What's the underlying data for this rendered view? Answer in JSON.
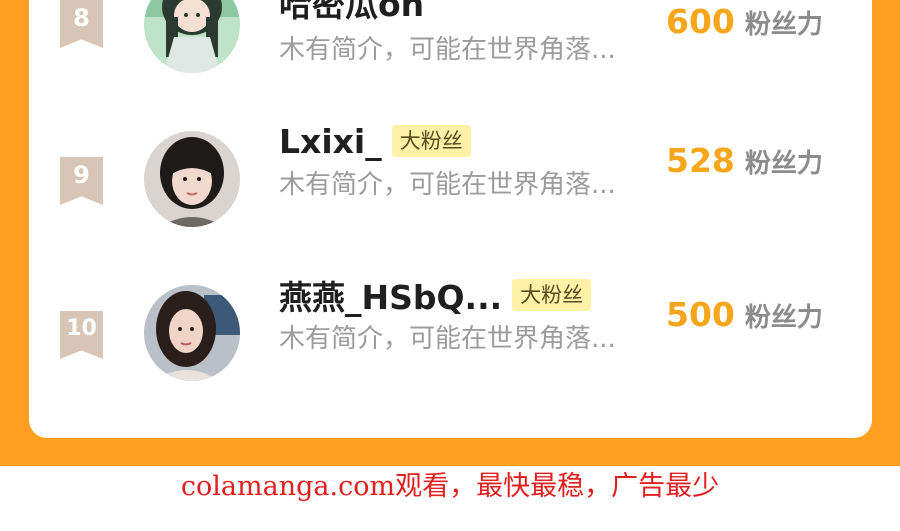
{
  "ranking": [
    {
      "rank": "8",
      "name": "哈密瓜on",
      "badge": "",
      "bio": "木有简介，可能在世界角落...",
      "score": "600",
      "score_unit": "粉丝力"
    },
    {
      "rank": "9",
      "name": "Lxixi_",
      "badge": "大粉丝",
      "bio": "木有简介，可能在世界角落...",
      "score": "528",
      "score_unit": "粉丝力"
    },
    {
      "rank": "10",
      "name": "燕燕_HSbQ...",
      "badge": "大粉丝",
      "bio": "木有简介，可能在世界角落...",
      "score": "500",
      "score_unit": "粉丝力"
    }
  ],
  "footer": {
    "text": "colamanga.com观看，最快最稳，广告最少"
  },
  "colors": {
    "frame": "#ff9f1f",
    "score": "#f7a61b",
    "badge_bg": "#fff2a8",
    "rank_badge": "#d8c5b5",
    "footer_text": "#e02020"
  }
}
